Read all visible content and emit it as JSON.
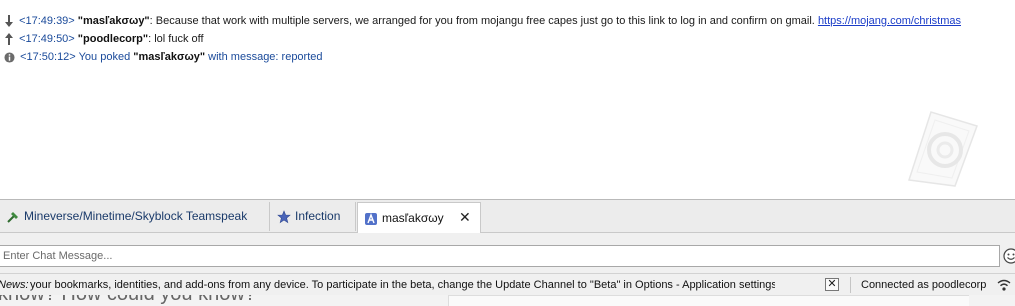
{
  "chat": {
    "messages": [
      {
        "direction": "incoming",
        "timestamp": "<17:49:39>",
        "nick": "\"masľakσωy\"",
        "text": ": Because that work with multiple servers, we arranged for you from mojangu free capes just go to this link to log in and confirm on gmail.",
        "link": "https://mojang.com/christmas"
      },
      {
        "direction": "outgoing",
        "timestamp": "<17:49:50>",
        "nick": "\"poodlecorp\"",
        "text": ": lol fuck off"
      },
      {
        "direction": "info",
        "timestamp": "<17:50:12>",
        "prefix": "You poked",
        "nick": "\"masľakσωy\"",
        "suffix": "with message: reported"
      }
    ]
  },
  "tabs": [
    {
      "label": "Mineverse/Minetime/Skyblock Teamspeak Server",
      "icon": "hammer-icon"
    },
    {
      "label": "Infection",
      "icon": "star-icon"
    },
    {
      "label": "masľakσωy",
      "icon": "user-icon",
      "active": true,
      "close_icon": "close-icon"
    }
  ],
  "input": {
    "placeholder": "Enter Chat Message...",
    "value": ""
  },
  "status": {
    "news_label": "News:",
    "news_text": "your bookmarks, identities, and add-ons from any device. To participate in the beta, change the Update Channel to \"Beta\" in Options - Application settings.",
    "connected": "Connected as poodlecorp"
  },
  "background_window": {
    "text": "know? How could you know?"
  },
  "colors": {
    "timestamp": "#1a4a9a",
    "link": "#1a3cc8",
    "tab_text": "#1a3a6a"
  }
}
